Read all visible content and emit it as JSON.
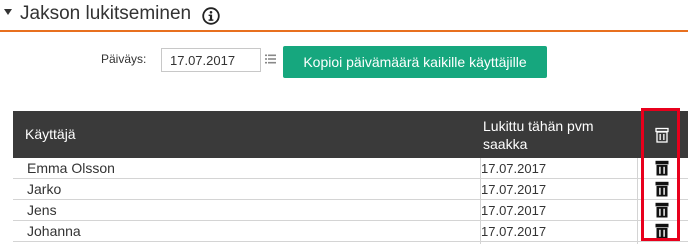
{
  "section": {
    "title": "Jakson lukitseminen",
    "caret_icon": "caret-down-icon",
    "info_icon": "info-circle-icon"
  },
  "date_form": {
    "label": "Päiväys:",
    "value": "17.07.2017",
    "list_icon": "list-icon",
    "copy_button_label": "Kopioi päivämäärä kaikille käyttäjille"
  },
  "table": {
    "columns": {
      "user": "Käyttäjä",
      "locked_until": "Lukittu tähän pvm saakka",
      "delete_icon": "trash-icon"
    },
    "rows": [
      {
        "name": "Emma Olsson",
        "date": "17.07.2017"
      },
      {
        "name": "Jarko",
        "date": "17.07.2017"
      },
      {
        "name": "Jens",
        "date": "17.07.2017"
      },
      {
        "name": "Johanna",
        "date": "17.07.2017"
      }
    ]
  },
  "colors": {
    "accent_orange": "#e8701f",
    "button_green": "#16a77e",
    "header_dark": "#3a3a3a",
    "highlight_red": "#e8001c"
  }
}
